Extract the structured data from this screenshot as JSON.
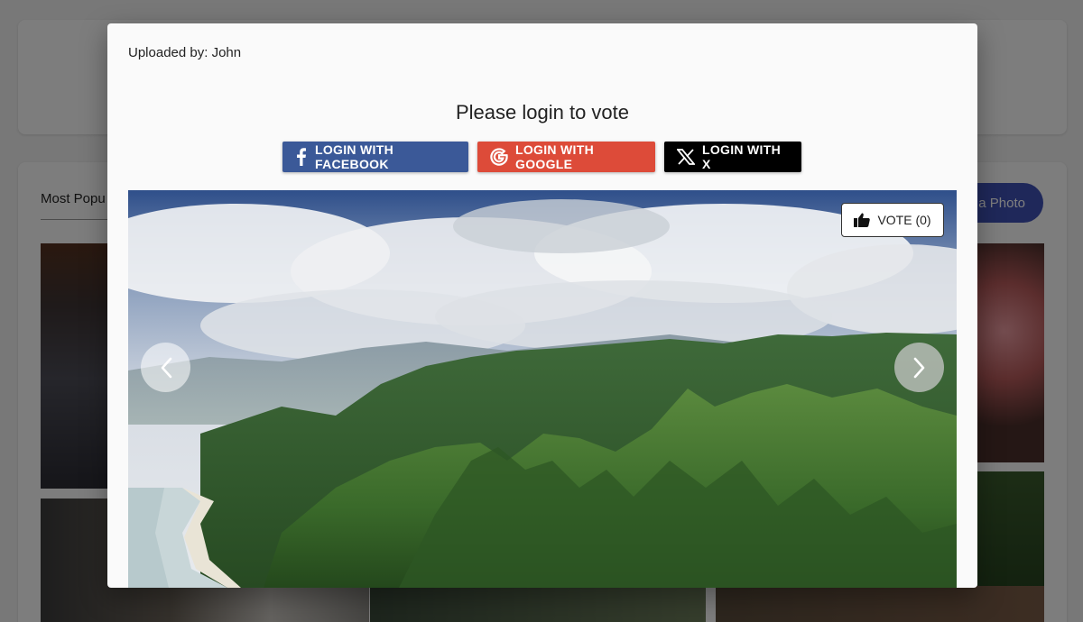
{
  "background": {
    "tab_label": "Most Popu",
    "upload_label": "a Photo"
  },
  "modal": {
    "uploaded_by": "Uploaded by: John",
    "prompt": "Please login to vote",
    "login": {
      "facebook": "LOGIN WITH FACEBOOK",
      "google": "LOGIN WITH GOOGLE",
      "x": "LOGIN WITH X"
    },
    "vote_label": "VOTE (0)",
    "colors": {
      "facebook": "#3b5998",
      "google": "#dd4b39",
      "x": "#000000"
    },
    "icons": {
      "facebook": "facebook-icon",
      "google": "google-icon",
      "x": "x-logo-icon",
      "vote": "thumbs-up-icon",
      "prev": "chevron-left-icon",
      "next": "chevron-right-icon"
    }
  }
}
